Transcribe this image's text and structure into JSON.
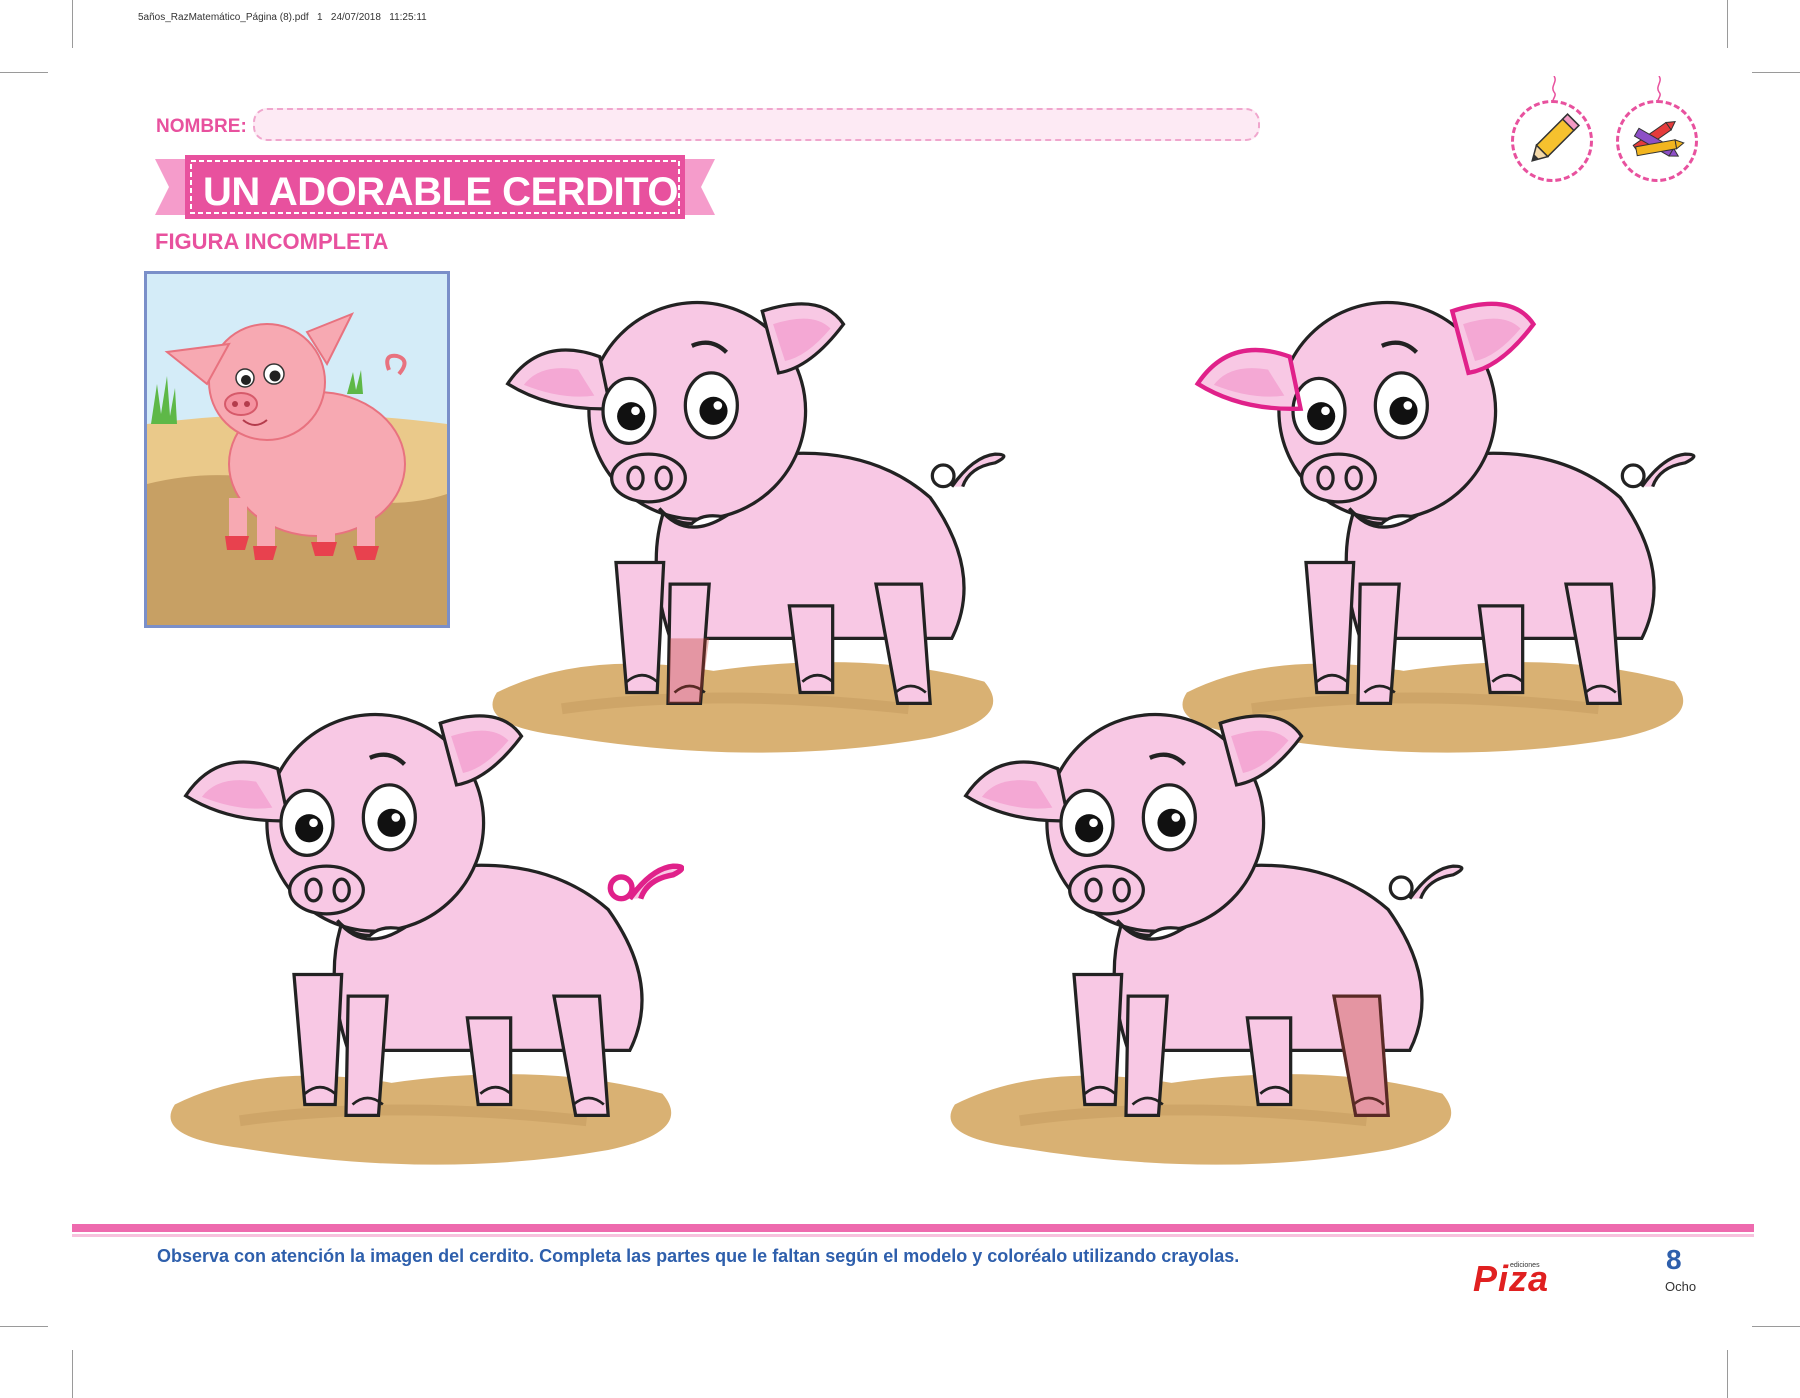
{
  "file_info": "5años_RazMatemático_Página (8).pdf   1   24/07/2018   11:25:11",
  "header": {
    "name_label": "NOMBRE:",
    "title": "UN ADORABLE CERDITO",
    "subtitle": "FIGURA INCOMPLETA"
  },
  "tools": [
    {
      "icon": "pencil-icon"
    },
    {
      "icon": "crayons-icon"
    }
  ],
  "footer": {
    "instructions": "Observa con atención la imagen del cerdito. Completa las partes que le faltan según el modelo y coloréalo utilizando crayolas.",
    "brand_small": "ediciones",
    "brand": "Piza",
    "page_number": "8",
    "page_word": "Ocho"
  },
  "colors": {
    "accent_pink": "#e8519e",
    "pig_fill": "#f8c8e4",
    "mud": "#d9b173",
    "text_blue": "#2e5fac"
  }
}
